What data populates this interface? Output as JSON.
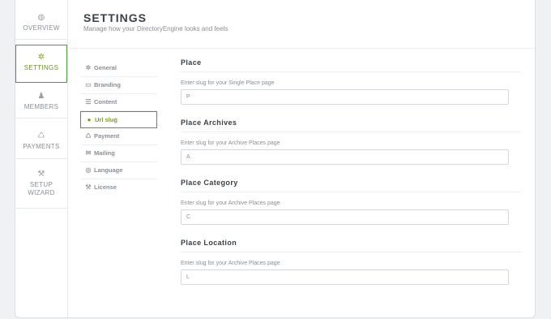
{
  "left_nav": [
    {
      "label": "OVERVIEW",
      "icon": "dashboard-icon"
    },
    {
      "label": "SETTINGS",
      "icon": "gear-icon"
    },
    {
      "label": "MEMBERS",
      "icon": "user-icon"
    },
    {
      "label": "PAYMENTS",
      "icon": "piggy-bank-icon"
    },
    {
      "label": "SETUP WIZARD",
      "icon": "wrench-icon"
    }
  ],
  "header": {
    "title": "SETTINGS",
    "subtitle": "Manage how your DirectoryEngine looks and feels"
  },
  "sub_nav": [
    {
      "label": "General",
      "icon": "gear-icon"
    },
    {
      "label": "Branding",
      "icon": "book-icon"
    },
    {
      "label": "Content",
      "icon": "list-icon"
    },
    {
      "label": "Url slug",
      "icon": "info-icon"
    },
    {
      "label": "Payment",
      "icon": "piggy-bank-icon"
    },
    {
      "label": "Mailing",
      "icon": "mail-icon"
    },
    {
      "label": "Language",
      "icon": "globe-icon"
    },
    {
      "label": "License",
      "icon": "wrench-icon"
    }
  ],
  "sections": [
    {
      "title": "Place",
      "label": "Enter slug for your Single Place page",
      "value": "P"
    },
    {
      "title": "Place Archives",
      "label": "Enter slug for your Archive Places page",
      "value": "A"
    },
    {
      "title": "Place Category",
      "label": "Enter slug for your Archive Places page",
      "value": "C"
    },
    {
      "title": "Place Location",
      "label": "Enter slug for your Archive Places page",
      "value": "L"
    }
  ],
  "colors": {
    "accent": "#4a9c3a",
    "text": "#3b4046",
    "muted": "#8a8f95"
  }
}
